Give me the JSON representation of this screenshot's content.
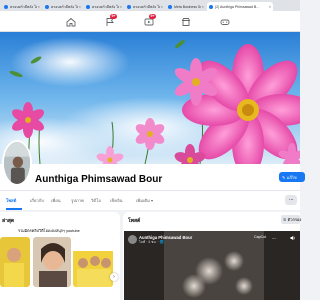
{
  "browser": {
    "tabs": [
      {
        "title": "ครอบครัวมีพลัง โพสต์และร...",
        "active": false
      },
      {
        "title": "ครอบครัวมีพลัง โพสต์และร...",
        "active": false
      },
      {
        "title": "ครอบครัวมีพลัง โพสต์และร...",
        "active": false
      },
      {
        "title": "ครอบครัวมีพลัง โพสต์และร...",
        "active": false
      },
      {
        "title": "Meta Business Suite",
        "active": false
      },
      {
        "title": "(2) Aunthiga Phimsawad B...",
        "active": true
      }
    ]
  },
  "fbnav": {
    "notif_badge_1": "9+",
    "notif_badge_2": "9+",
    "icons": [
      "home-icon",
      "flag-icon",
      "video-icon",
      "marketplace-icon",
      "gaming-icon"
    ]
  },
  "profile": {
    "name": "Aunthiga Phimsawad Bour",
    "edit_label": "แก้ไข"
  },
  "profile_nav": {
    "items": [
      "โพสต์",
      "เกี่ยวกับ",
      "เพื่อน",
      "รูปภาพ",
      "วิดีโอ",
      "เช็คอิน",
      "เพิ่มเติม"
    ],
    "more_label": "···"
  },
  "left_card": {
    "title": "ล่าสุด",
    "subtitle": "รวมมิตรคลิปวิดีโอเพลงสนุกๆ youtube"
  },
  "right_card": {
    "title": "โพสต์",
    "filter_label": "ตัวกรอง"
  },
  "video_post": {
    "author": "Aunthiga Phimsawad Bour",
    "meta": "ไลฟ์ · 4 ชม. · 🌐",
    "overlay": "CapCut",
    "more": "···"
  },
  "colors": {
    "accent": "#1877f2",
    "badge": "#e41e3f"
  }
}
